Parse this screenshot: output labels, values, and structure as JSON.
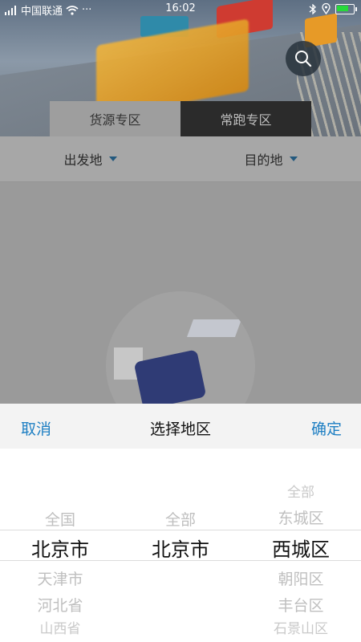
{
  "statusbar": {
    "carrier": "中国联通",
    "dots": "···",
    "time": "16:02"
  },
  "hero": {
    "search_icon": "search-icon"
  },
  "tabs": [
    {
      "label": "货源专区",
      "active": true
    },
    {
      "label": "常跑专区",
      "active": false
    }
  ],
  "filters": {
    "origin": "出发地",
    "destination": "目的地"
  },
  "picker": {
    "cancel": "取消",
    "title": "选择地区",
    "confirm": "确定",
    "col1": [
      "全国",
      "北京市",
      "天津市",
      "河北省",
      "山西省"
    ],
    "col2": [
      "全部",
      "北京市"
    ],
    "col3": [
      "全部",
      "东城区",
      "西城区",
      "朝阳区",
      "丰台区",
      "石景山区"
    ]
  },
  "colors": {
    "accent": "#1e7fc3",
    "battery": "#27d93b"
  }
}
